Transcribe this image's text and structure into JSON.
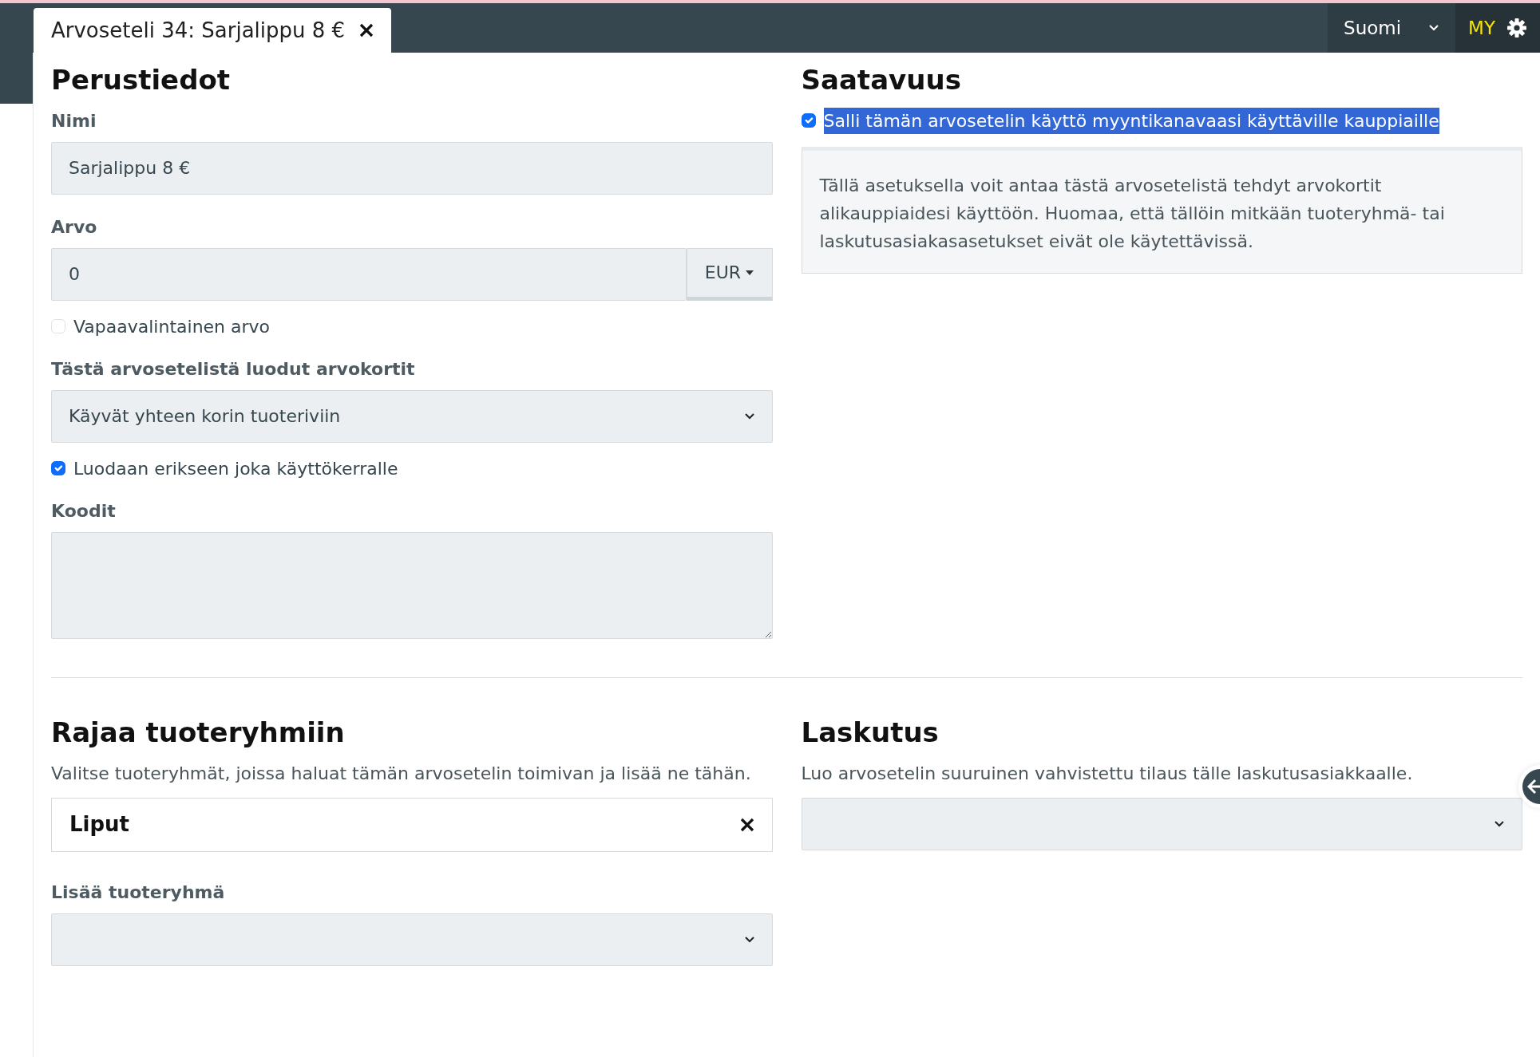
{
  "tab": {
    "title": "Arvoseteli 34: Sarjalippu 8 €"
  },
  "topbar": {
    "language": "Suomi",
    "user": "MY"
  },
  "basics": {
    "heading": "Perustiedot",
    "name_label": "Nimi",
    "name_value": "Sarjalippu 8 €",
    "value_label": "Arvo",
    "value": "0",
    "currency": "EUR",
    "free_value": {
      "label": "Vapaavalintainen arvo",
      "checked": false
    },
    "cards_label": "Tästä arvosetelistä luodut arvokortit",
    "cards_value": "Käyvät yhteen korin tuoteriviin",
    "separate": {
      "label": "Luodaan erikseen joka käyttökerralle",
      "checked": true
    },
    "codes_label": "Koodit"
  },
  "availability": {
    "heading": "Saatavuus",
    "allow": {
      "label": "Salli tämän arvosetelin käyttö myyntikanavaasi käyttäville kauppiaille",
      "checked": true,
      "highlighted": true
    },
    "info": "Tällä asetuksella voit antaa tästä arvosetelistä tehdyt arvokortit alikauppiaidesi käyttöön. Huomaa, että tällöin mitkään tuoteryhmä- tai laskutusasiakasasetukset eivät ole käytettävissä."
  },
  "groups": {
    "heading": "Rajaa tuoteryhmiin",
    "description": "Valitse tuoteryhmät, joissa haluat tämän arvosetelin toimivan ja lisää ne tähän.",
    "items": [
      {
        "name": "Liput"
      }
    ],
    "add_label": "Lisää tuoteryhmä"
  },
  "billing": {
    "heading": "Laskutus",
    "description": "Luo arvosetelin suuruinen vahvistettu tilaus tälle laskutusasiakkaalle."
  }
}
